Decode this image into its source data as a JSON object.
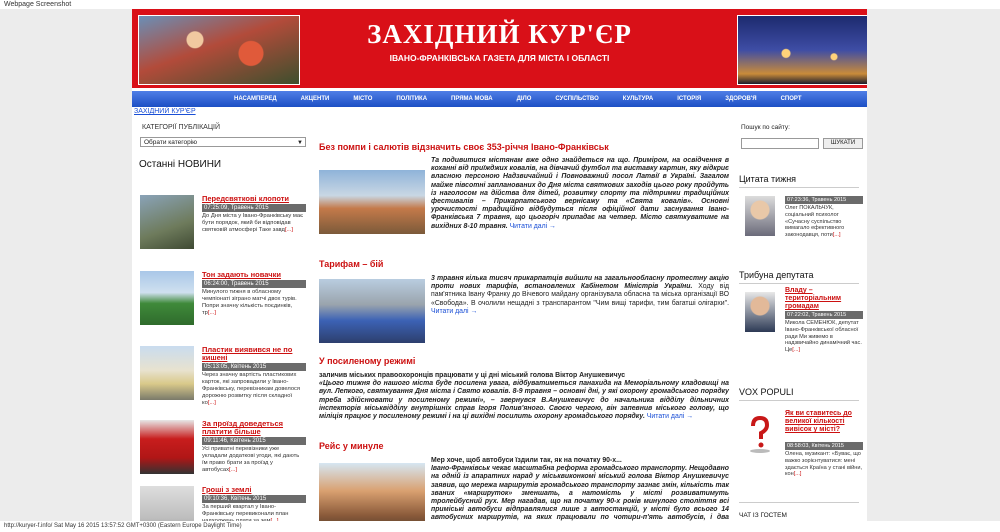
{
  "window_label": "Webpage Screenshot",
  "header": {
    "title": "ЗАХІДНИЙ КУР'ЄР",
    "subtitle": "ІВАНО-ФРАНКІВСЬКА ГАЗЕТА ДЛЯ МІСТА І ОБЛАСТІ"
  },
  "nav": [
    "НАСАМПЕРЕД",
    "АКЦЕНТИ",
    "МІСТО",
    "ПОЛІТИКА",
    "ПРЯМА МОВА",
    "ДІЛО",
    "СУСПІЛЬСТВО",
    "КУЛЬТУРА",
    "ІСТОРІЯ",
    "ЗДОРОВ'Я",
    "СПОРТ"
  ],
  "breadcrumb": "ЗАХІДНИЙ КУР'ЄР",
  "left": {
    "categories_heading": "КАТЕГОРІЇ ПУБЛІКАЦІЙ",
    "category_select": "Обрати категорію",
    "news_heading": "Останні НОВИНИ",
    "items": [
      {
        "title": "Передсвяткові клопоти",
        "date": "07:25:09, Травень 2015",
        "text": "До Дня міста у Івано-Франківську має бути порядок, який би відповідав святковій атмосфері Таке завд",
        "more": "[...]"
      },
      {
        "title": "Тон задають новачки",
        "date": "06:24:00, Травень 2015",
        "text": "Минулого тижня в обласному чемпіонаті зіграно матчі двох турів. Попри значну кількість поєдинків, тр",
        "more": "[...]"
      },
      {
        "title": "Пластик виявився не по кишені",
        "date": "05:13:05, Квітень 2015",
        "text": "Через значну вартість пластикових карток, які запровадили у Івано-Франківську, перевізникам довелося дорожню розвитку після складної ко",
        "more": "[...]"
      },
      {
        "title": "За проїзд доведеться платити більше",
        "date": "09:11:46, Квітень 2015",
        "text": "Усі приватні перевізники уже укладали додаткові угоди, які дають їм право брати за проїзд у автобусах",
        "more": "[...]"
      },
      {
        "title": "Гроші з землі",
        "date": "09:10:36, Квітень 2015",
        "text": "За перший квартал у Івано-Франківську перевиконали план надходжень плати за зем",
        "more": "[...]"
      }
    ]
  },
  "articles": [
    {
      "title": "Без помпи і салютів відзначить своє 353-річчя Івано-Франківськ",
      "text": "Та подивитися містянам вже одно знайдеться на що. Приміром, на освідчення в коханні від приїжджих ковалів, на дівчачий футбол та виставку картин, яку відкриє власною персоною Надзвичайний і Повноважний посол Латвії в Україні. Загалом майже півсотні запланованих до Дня міста святкових заходів цього року пройдуть із наголосом на дійства для дітей, розвитку спорту та підтримки традиційних фестивалів – Прикарпатського вернісажу та «Свята ковалів». Основні урочистості традиційно відбудуться після офіційної дати заснування Івано-Франківська 7 травня, що цьогоріч припадає на четвер. Місто святкуватиме на вихідних 8-10 травня.",
      "more": "Читати далі →"
    },
    {
      "title": "Тарифам – бій",
      "text_bold": "3 травня кілька тисяч прикарпатців вийшли на загальнообласну протестну акцію проти нових тарифів, встановлених Кабінетом Міністрів України.",
      "text": "Ходу від пам'ятника Івану Франку до Вічевого майдану організувала обласна та міська організації ВО «Свобода». В очолили нещадні з транспарантом \"Чим вищі тарифи, тим багатші олігархи\".",
      "more": "Читати далі →"
    },
    {
      "title": "У посиленому режимі",
      "text_bold": "заличив міських правоохоронців працювати у ці дні міський голова Віктор Анушкевичус",
      "text": "«Цього тижня до нашого міста буде посилена увага, відбуватиметься панахида на Меморіальному кладовищі на вул. Лепкого, святкування Дня міста і Свято ковалів. 8-9 травня – основні дні, у які охорону громадського порядку треба здійснювати у посиленому режимі», – звернувся В.Анушкевичус до начальника відділу дільничних інспекторів міськвідділу внутрішніх справ Ігоря Полив'яного. Своєю чергою, він запевнив міського голову, що міліція працює у посиленому режимі і на ці вихідні посилить охорону громадського порядку.",
      "more": "Читати далі →"
    },
    {
      "title": "Рейс у минуле",
      "text_bold": "Мер хоче, щоб автобуси їздили так, як на початку 90-х...",
      "text": "Івано-Франківськ чекає масштабна реформа громадського транспорту. Нещодавно на одній із апаратних нарад у міськвиконкомі міський голова Віктор Анушкевичус заявив, що мережа маршрутів громадського транспорту зазнає змін, кількість так званих «маршруток» зменшать, а натомість у місті розвиватимуть тролейбусний рух. Мер нагадав, що на початку 90-х років минулого століття всі приміські автобуси відправлялися лише з автостанцій, у місті було всього 14 автобусних маршрутів, на яких працювали по чотири-п'ять автобусів, і два тролейбусні. Але при цьому",
      "more": ""
    }
  ],
  "right": {
    "search_label": "Пошук по сайту:",
    "search_placeholder": "",
    "search_button": "ШУКАТИ",
    "quote_heading": "Цитата тижня",
    "quote": {
      "date": "07:23:36, Травень 2015",
      "text": "Олег ПОКАЛЬЧУК, соціальний психолог «Сучасну суспільство вимагало ефективного законодавця, поти",
      "more": "[...]"
    },
    "tribune_heading": "Трибуна депутата",
    "tribune": {
      "title": "Владу – територіальним громадам",
      "date": "07:22:02, Травень 2015",
      "text": "Микола СЕМЕНЮК, депутат Івано-Франківської обласної ради Ми живемо в надзвичайно динамічний час. Це",
      "more": "[...]"
    },
    "vox_heading": "VOX POPULI",
    "vox": {
      "title": "Як ви ставитесь до великої кількості вивісок у місті?",
      "date": "08:58:03, Квітень 2015",
      "text": "Олена, музикант: «Буває, що важко зорієнтуватися: мені здається Країна у стані війни, кон",
      "more": "[...]"
    },
    "guests_heading": "ЧАТ ІЗ ГОСТЕМ"
  },
  "status_bar": "http://kuryer-f.info/ Sat May 16 2015 13:57:52 GMT+0300 (Eastern Europe Daylight Time)"
}
